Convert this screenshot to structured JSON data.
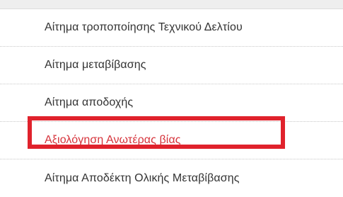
{
  "menu": {
    "items": [
      {
        "label": "Αίτημα τροποποίησης Τεχνικού Δελτίου",
        "active": false
      },
      {
        "label": "Αίτημα μεταβίβασης",
        "active": false
      },
      {
        "label": "Αίτημα αποδοχής",
        "active": false
      },
      {
        "label": "Αξιολόγηση Ανωτέρας βίας",
        "active": true
      },
      {
        "label": "Αίτημα Αποδέκτη Ολικής Μεταβίβασης",
        "active": false
      }
    ]
  },
  "colors": {
    "text": "#333333",
    "active_text": "#d6333b",
    "highlight_border": "#e0222c",
    "divider": "#c8c8c8",
    "top_strip": "#eeeeee"
  }
}
